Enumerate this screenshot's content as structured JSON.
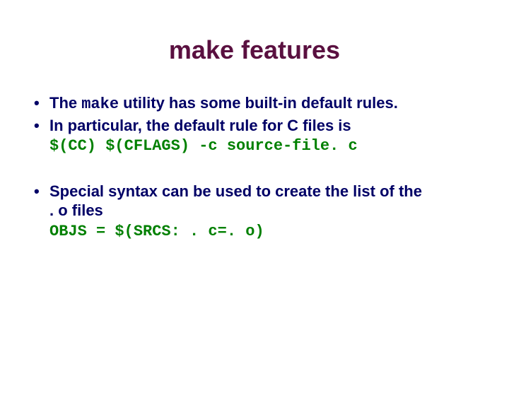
{
  "title": "make features",
  "bullets": {
    "b1_pre": "The ",
    "b1_code": "make",
    "b1_post": " utility has some built-in default rules.",
    "b2": "In particular, the default rule for C files is",
    "code1": "$(CC) $(CFLAGS) -c source-file. c",
    "b3_line1": "Special syntax can  be used to create the list of the",
    "b3_line2": ". o files",
    "code2": "OBJS = $(SRCS: . c=. o)"
  }
}
